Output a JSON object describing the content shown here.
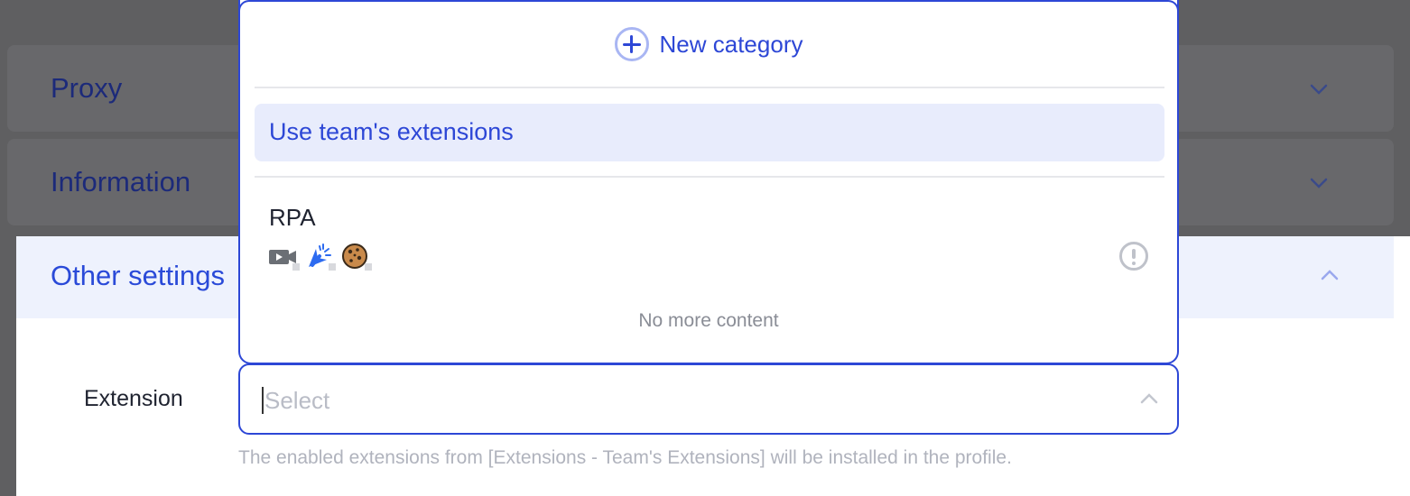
{
  "sections": {
    "proxy": {
      "title": "Proxy"
    },
    "information": {
      "title": "Information"
    },
    "other_settings": {
      "title": "Other settings"
    }
  },
  "extension_field": {
    "label": "Extension",
    "placeholder": "Select",
    "hint": "The enabled extensions from [Extensions - Team's Extensions] will be installed in the profile."
  },
  "dropdown": {
    "new_category_label": "New category",
    "use_team_label": "Use team's extensions",
    "categories": [
      {
        "name": "RPA",
        "icons": [
          "video-camera-icon",
          "cursor-click-icon",
          "cookie-icon"
        ]
      }
    ],
    "end_text": "No more content"
  },
  "colors": {
    "accent": "#2d47d6",
    "highlight_bg": "#e8ecfc",
    "overlay": "#5f5f61"
  }
}
